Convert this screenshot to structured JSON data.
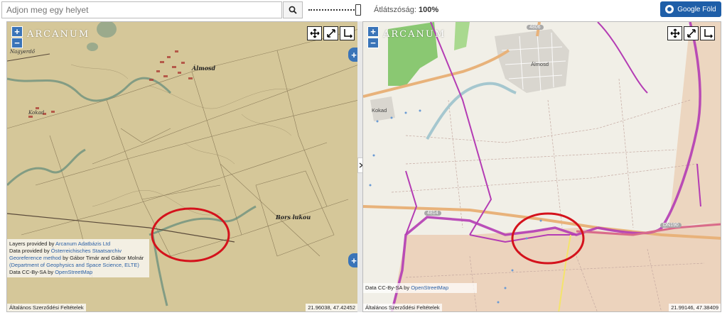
{
  "toolbar": {
    "search_placeholder": "Adjon meg egy helyet",
    "opacity_label": "Átlátszóság:",
    "opacity_value": "100%",
    "google_earth_label": "Google Föld"
  },
  "left_map": {
    "logo": "ARCANUM",
    "place_labels": {
      "almosd": "Álmosd",
      "kokad": "Kokad",
      "nagyerdo": "Nagyerdő",
      "bors": "Bors lukou"
    },
    "attribution": {
      "layers_prefix": "Layers provided by",
      "layers_link": "Arcanum Adatbázis Ltd",
      "data_prefix": "Data provided by",
      "data_link": "Österreichisches Staatsarchiv",
      "geo_link": "Georeference method",
      "geo_by": "by Gábor Timár and Gábor Molnár",
      "geo_dept": "(Department of Geophysics and Space Science, ELTE)",
      "osm_prefix": "Data CC-By-SA by",
      "osm_link": "OpenStreetMap"
    },
    "terms": "Általános Szerződési Feltételek",
    "coords": "21.96038, 47.42452"
  },
  "right_map": {
    "logo": "ARCANUM",
    "place_labels": {
      "almosd": "Álmosd",
      "kokad": "Kokad"
    },
    "road_badges": {
      "r4806": "4806",
      "r4814": "4814",
      "dn190": "DN190"
    },
    "attribution": {
      "osm_prefix": "Data CC-By-SA by",
      "osm_link": "OpenStreetMap"
    },
    "terms": "Általános Szerződési Feltételek",
    "coords": "21.99146, 47.38409"
  },
  "colors": {
    "historic_map_bg": "#d7c99c",
    "osm_bg": "#f1efe7",
    "circle": "#d4121c",
    "border_purple": "#b43cb4",
    "button_blue": "#3a74b8",
    "google_earth_blue": "#1f5fa8"
  },
  "icons": [
    "search-icon",
    "pan-icon",
    "expand-icon",
    "corner-icon",
    "globe-icon",
    "chevron-right-icon"
  ]
}
